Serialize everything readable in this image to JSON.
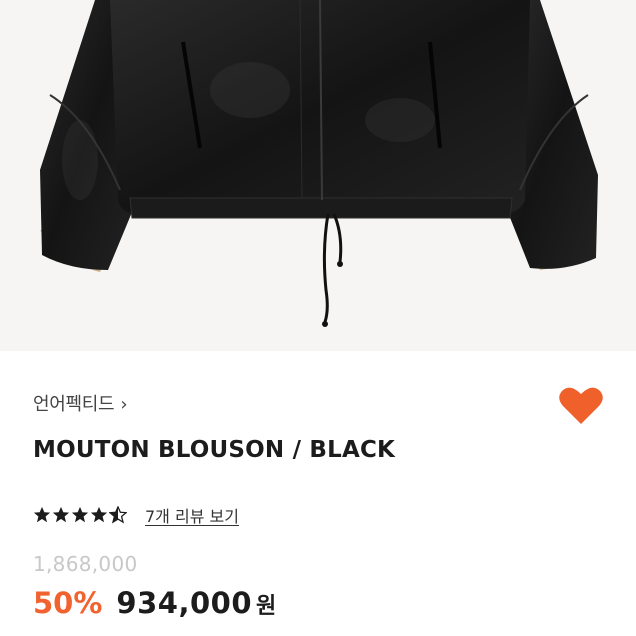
{
  "product": {
    "brand": "언어펙티드",
    "brand_chevron": "›",
    "title": "MOUTON BLOUSON / BLACK",
    "rating": 4.5,
    "review_link": "7개 리뷰 보기",
    "original_price": "1,868,000",
    "discount": "50%",
    "price": "934,000",
    "currency": "원",
    "favorited": true
  },
  "colors": {
    "accent": "#f2622e",
    "heart": "#f0602b",
    "text": "#1c1c1c",
    "muted": "#c8c8c8",
    "image_background": "#f6f5f3",
    "jacket": "#141414"
  },
  "icons": {
    "favorite": "heart-icon",
    "brand_link": "chevron-right-icon",
    "star": "star-icon"
  }
}
